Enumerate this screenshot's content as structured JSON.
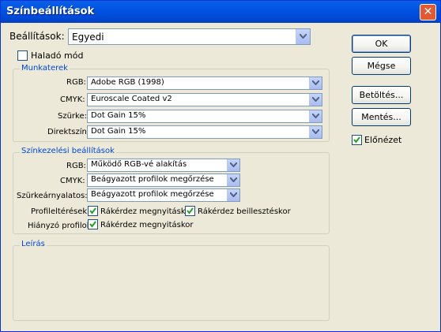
{
  "window": {
    "title": "Színbeállítások"
  },
  "settings": {
    "label": "Beállítások:",
    "value": "Egyedi"
  },
  "advanced_mode": {
    "label": "Haladó mód",
    "checked": false
  },
  "workspaces": {
    "legend": "Munkaterek",
    "rows": [
      {
        "label": "RGB:",
        "value": "Adobe RGB (1998)"
      },
      {
        "label": "CMYK:",
        "value": "Euroscale Coated v2"
      },
      {
        "label": "Szürke:",
        "value": "Dot Gain 15%"
      },
      {
        "label": "Direktszín:",
        "value": "Dot Gain 15%"
      }
    ]
  },
  "color_management": {
    "legend": "Színkezelési beállítások",
    "rows": [
      {
        "label": "RGB:",
        "value": "Működő RGB-vé alakítás"
      },
      {
        "label": "CMYK:",
        "value": "Beágyazott profilok megőrzése"
      },
      {
        "label": "Szürkeárnyalatos:",
        "value": "Beágyazott profilok megőrzése"
      }
    ],
    "profile_mismatch": {
      "label": "Profileltérések:",
      "ask_open": "Rákérdez megnyitáskor",
      "ask_paste": "Rákérdez beillesztéskor"
    },
    "missing_profiles": {
      "label": "Hiányzó profilok:",
      "ask_open": "Rákérdez megnyitáskor"
    }
  },
  "description": {
    "legend": "Leírás"
  },
  "buttons": {
    "ok": "OK",
    "cancel": "Mégse",
    "load": "Betöltés...",
    "save": "Mentés..."
  },
  "preview": {
    "label": "Előnézet",
    "checked": true
  },
  "colors": {
    "titlebar": "#0054e3",
    "legend_text": "#0046d5",
    "face": "#ece9d8"
  }
}
